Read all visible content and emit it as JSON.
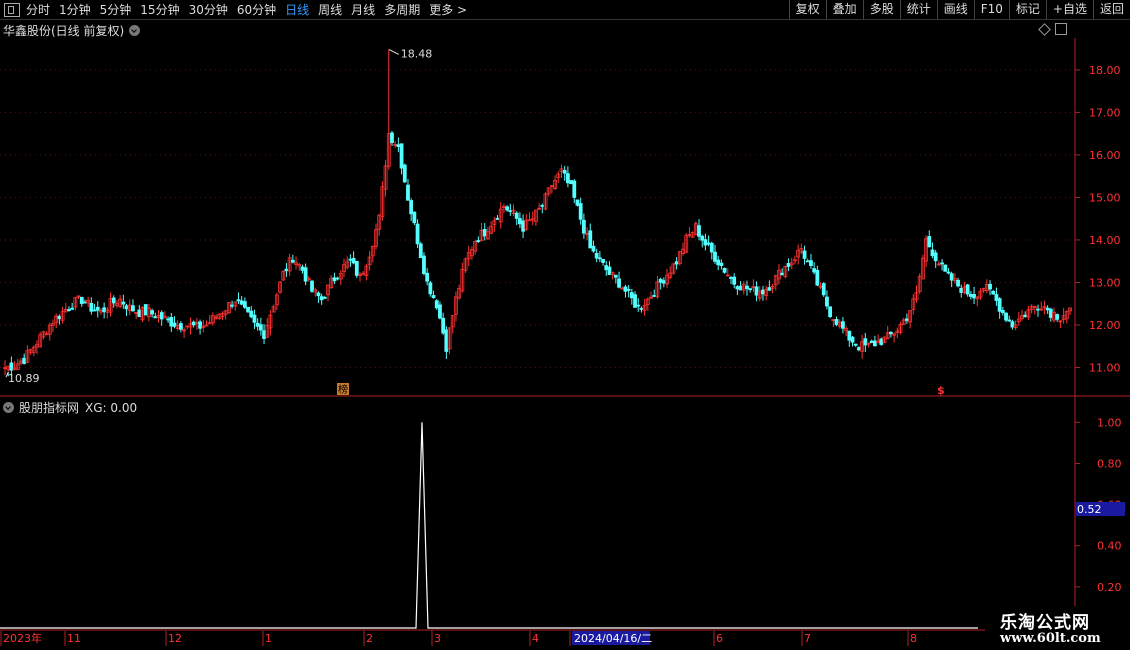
{
  "toolbar": {
    "periods": [
      "分时",
      "1分钟",
      "5分钟",
      "15分钟",
      "30分钟",
      "60分钟",
      "日线",
      "周线",
      "月线",
      "多周期",
      "更多 >"
    ],
    "active_period": "日线",
    "buttons": [
      "复权",
      "叠加",
      "多股",
      "统计",
      "画线",
      "F10",
      "标记",
      "+自选",
      "返回"
    ]
  },
  "main_chart": {
    "title": "华鑫股份(日线 前复权)",
    "high_label": "18.48",
    "low_label": "10.89",
    "marker_bang": "榜",
    "marker_s": "$"
  },
  "indicator": {
    "title": "股朋指标网",
    "xg_label": "XG: 0.00",
    "cursor_value": "0.52"
  },
  "date_axis": {
    "labels": [
      "2023年",
      "11",
      "12",
      "1",
      "2",
      "3",
      "4",
      "2024/04/16/二",
      "6",
      "7",
      "8"
    ]
  },
  "watermark": {
    "line1": "乐淘公式网",
    "line2": "www.60lt.com"
  },
  "colors": {
    "up": "#ff3232",
    "down": "#54ffff",
    "axis": "#b02020",
    "period_active": "#2f9bff",
    "indicator_line": "#ffffff"
  },
  "chart_data": [
    {
      "type": "candlestick",
      "title": "华鑫股份(日线 前复权)",
      "y_ticks": [
        11.0,
        12.0,
        13.0,
        14.0,
        15.0,
        16.0,
        17.0,
        18.0
      ],
      "y_tick_labels": [
        "11.00",
        "12.00",
        "13.00",
        "14.00",
        "15.00",
        "16.00",
        "17.00",
        "18.00"
      ],
      "ylim": [
        10.4,
        18.75
      ],
      "annotations": [
        {
          "label": "18.48",
          "value": 18.48
        },
        {
          "label": "10.89",
          "value": 10.89
        }
      ],
      "close_path": [
        11.0,
        11.05,
        11.2,
        11.5,
        11.8,
        12.1,
        12.3,
        12.5,
        12.6,
        12.4,
        12.3,
        12.5,
        12.6,
        12.4,
        12.3,
        12.3,
        12.2,
        12.1,
        12.0,
        12.0,
        11.95,
        12.0,
        12.2,
        12.4,
        12.6,
        12.3,
        12.0,
        11.8,
        12.5,
        13.2,
        13.6,
        13.3,
        12.8,
        12.6,
        13.0,
        13.3,
        13.5,
        13.1,
        13.7,
        14.5,
        16.5,
        16.2,
        15.0,
        14.0,
        13.0,
        12.5,
        11.5,
        12.6,
        13.5,
        14.0,
        14.2,
        14.5,
        14.8,
        14.6,
        14.3,
        14.5,
        14.8,
        15.3,
        15.6,
        15.2,
        14.5,
        13.8,
        13.5,
        13.2,
        13.0,
        12.7,
        12.4,
        12.6,
        12.9,
        13.2,
        13.5,
        14.0,
        14.3,
        13.9,
        13.6,
        13.3,
        13.0,
        12.9,
        12.8,
        12.8,
        13.0,
        13.3,
        13.5,
        13.8,
        13.3,
        12.8,
        12.3,
        12.0,
        11.7,
        11.5,
        11.5,
        11.6,
        11.7,
        11.9,
        12.2,
        12.7,
        14.0,
        13.6,
        13.2,
        13.0,
        12.8,
        12.7,
        12.9,
        12.7,
        12.3,
        12.0,
        12.2,
        12.4,
        12.5,
        12.3,
        12.2,
        12.4
      ],
      "series_high": 18.48,
      "series_low": 10.89
    },
    {
      "type": "line",
      "series": [
        {
          "name": "XG",
          "values_note": "0 everywhere except a single spike to 1.00 near early March"
        }
      ],
      "y_tick_labels": [
        "0.20",
        "0.40",
        "0.60",
        "0.80",
        "1.00"
      ],
      "ylim": [
        0,
        1.05
      ]
    }
  ]
}
